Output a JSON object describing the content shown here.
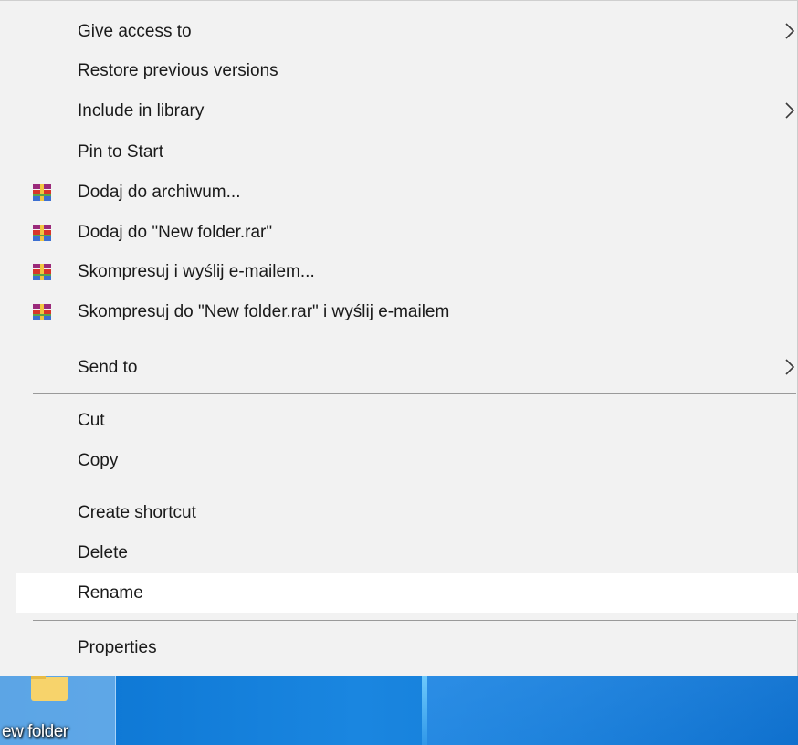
{
  "context_menu": {
    "items": [
      {
        "label": "Give access to"
      },
      {
        "label": "Restore previous versions"
      },
      {
        "label": "Include in library"
      },
      {
        "label": "Pin to Start"
      },
      {
        "label": "Dodaj do archiwum..."
      },
      {
        "label": "Dodaj do \"New folder.rar\""
      },
      {
        "label": "Skompresuj i wyślij e-mailem..."
      },
      {
        "label": "Skompresuj do \"New folder.rar\" i wyślij e-mailem"
      },
      {
        "label": "Send to"
      },
      {
        "label": "Cut"
      },
      {
        "label": "Copy"
      },
      {
        "label": "Create shortcut"
      },
      {
        "label": "Delete"
      },
      {
        "label": "Rename"
      },
      {
        "label": "Properties"
      }
    ],
    "submenu_icon": "chevron-right-icon",
    "archive_icon": "winrar-icon",
    "hovered_item": "Rename"
  },
  "desktop": {
    "folder_label": "ew folder",
    "folder_icon": "folder-icon",
    "accent": "#0a73d1"
  }
}
